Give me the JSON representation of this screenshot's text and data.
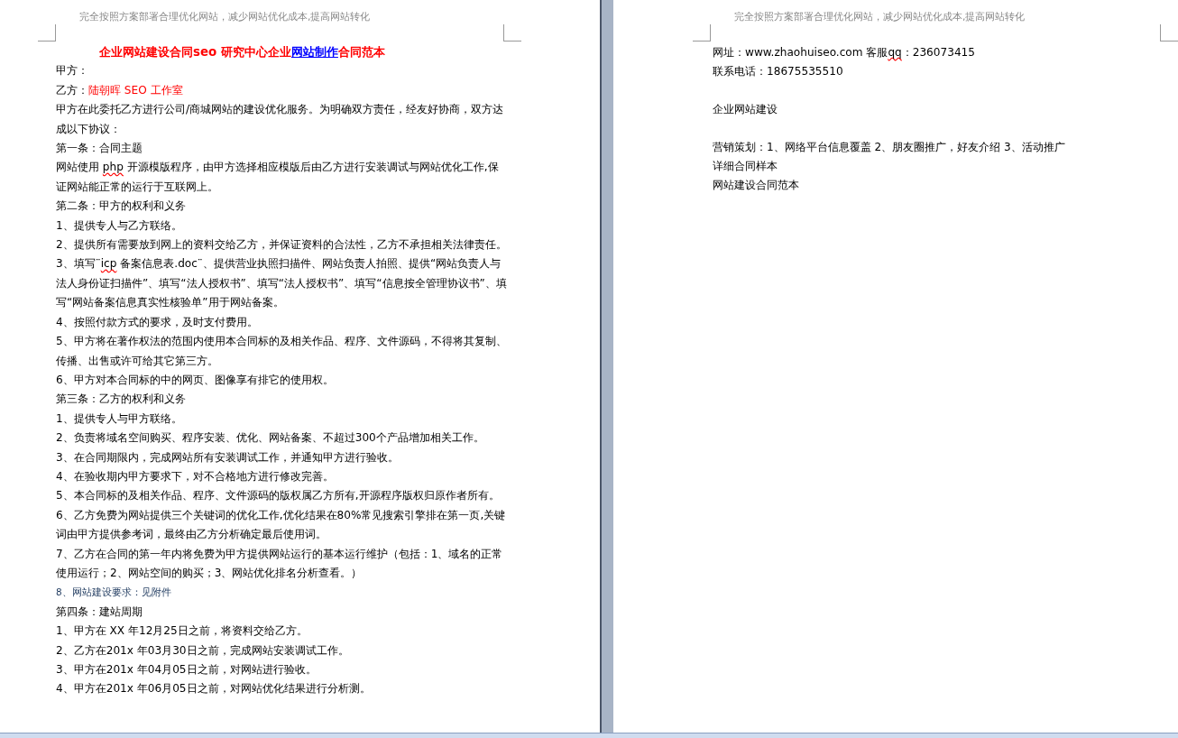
{
  "pages": [
    {
      "header": "完全按照方案部署合理优化网站，减少网站优化成本,提高网站转化",
      "paragraphs": [
        {
          "kind": "title",
          "runs": [
            {
              "text": "企业网站建设合同seo 研究中心企业",
              "kind": "red"
            },
            {
              "text": "网站制作",
              "kind": "link"
            },
            {
              "text": "合同范本",
              "kind": "red"
            }
          ]
        },
        {
          "kind": "body",
          "runs": [
            {
              "text": "甲方：",
              "kind": "normal"
            }
          ]
        },
        {
          "kind": "body",
          "runs": [
            {
              "text": "乙方：",
              "kind": "normal"
            },
            {
              "text": "陆朝晖 SEO 工作室",
              "kind": "red"
            }
          ]
        },
        {
          "kind": "body",
          "runs": [
            {
              "text": "甲方在此委托乙方进行公司/商城网站的建设优化服务。为明确双方责任，经友好协商，双方达成以下协议：",
              "kind": "normal"
            }
          ]
        },
        {
          "kind": "body",
          "runs": [
            {
              "text": "第一条：合同主题",
              "kind": "normal"
            }
          ]
        },
        {
          "kind": "body",
          "runs": [
            {
              "text": "网站使用 ",
              "kind": "normal"
            },
            {
              "text": "php",
              "kind": "spell"
            },
            {
              "text": " 开源模版程序，由甲方选择相应模版后由乙方进行安装调试与网站优化工作,保证网站能正常的运行于互联网上。",
              "kind": "normal"
            }
          ]
        },
        {
          "kind": "body",
          "runs": [
            {
              "text": "第二条：甲方的权利和义务",
              "kind": "normal"
            }
          ]
        },
        {
          "kind": "body",
          "runs": [
            {
              "text": "1、提供专人与乙方联络。",
              "kind": "normal"
            }
          ]
        },
        {
          "kind": "body",
          "runs": [
            {
              "text": "2、提供所有需要放到网上的资料交给乙方，并保证资料的合法性，乙方不承担相关法律责任。",
              "kind": "normal"
            }
          ]
        },
        {
          "kind": "body",
          "runs": [
            {
              "text": "3、填写¨",
              "kind": "normal"
            },
            {
              "text": "icp",
              "kind": "spell"
            },
            {
              "text": " 备案信息表.doc¨、提供营业执照扫描件、网站负责人拍照、提供“网站负责人与法人身份证扫描件”、填写“法人授权书”、填写“法人授权书”、填写“信息按全管理协议书”、填写“网站备案信息真实性核验单”用于网站备案。",
              "kind": "normal"
            }
          ]
        },
        {
          "kind": "body",
          "runs": [
            {
              "text": "4、按照付款方式的要求，及时支付费用。",
              "kind": "normal"
            }
          ]
        },
        {
          "kind": "body",
          "runs": [
            {
              "text": "5、甲方将在著作权法的范围内使用本合同标的及相关作品、程序、文件源码，不得将其复制、传播、出售或许可给其它第三方。",
              "kind": "normal"
            }
          ]
        },
        {
          "kind": "body",
          "runs": [
            {
              "text": "6、甲方对本合同标的中的网页、图像享有排它的使用权。",
              "kind": "normal"
            }
          ]
        },
        {
          "kind": "body",
          "runs": [
            {
              "text": "第三条：乙方的权利和义务",
              "kind": "normal"
            }
          ]
        },
        {
          "kind": "body",
          "runs": [
            {
              "text": "1、提供专人与甲方联络。",
              "kind": "normal"
            }
          ]
        },
        {
          "kind": "body",
          "runs": [
            {
              "text": "2、负责将域名空间购买、程序安装、优化、网站备案、不超过300个产品增加相关工作。",
              "kind": "normal"
            }
          ]
        },
        {
          "kind": "body",
          "runs": [
            {
              "text": "3、在合同期限内，完成网站所有安装调试工作，并通知甲方进行验收。",
              "kind": "normal"
            }
          ]
        },
        {
          "kind": "body",
          "runs": [
            {
              "text": "4、在验收期内甲方要求下，对不合格地方进行修改完善。",
              "kind": "normal"
            }
          ]
        },
        {
          "kind": "body",
          "runs": [
            {
              "text": "5、本合同标的及相关作品、程序、文件源码的版权属乙方所有,开源程序版权归原作者所有。",
              "kind": "normal"
            }
          ]
        },
        {
          "kind": "body",
          "runs": [
            {
              "text": "6、乙方免费为网站提供三个关键词的优化工作,优化结果在80%常见搜索引擎排在第一页,关键词由甲方提供参考词，最终由乙方分析确定最后使用词。",
              "kind": "normal"
            }
          ]
        },
        {
          "kind": "body",
          "runs": [
            {
              "text": "7、乙方在合同的第一年内将免费为甲方提供网站运行的基本运行维护（包括：1、域名的正常使用运行；2、网站空间的购买；3、网站优化排名分析查看。）",
              "kind": "normal"
            }
          ]
        },
        {
          "kind": "small",
          "runs": [
            {
              "text": "8、网站建设要求：见附件",
              "kind": "normal"
            }
          ]
        },
        {
          "kind": "body",
          "runs": [
            {
              "text": "第四条：建站周期",
              "kind": "normal"
            }
          ]
        },
        {
          "kind": "body",
          "runs": [
            {
              "text": "1、甲方在 XX 年12月25日之前，将资料交给乙方。",
              "kind": "normal"
            }
          ]
        },
        {
          "kind": "body",
          "runs": [
            {
              "text": "2、乙方在201x 年03月30日之前，完成网站安装调试工作。",
              "kind": "normal"
            }
          ]
        },
        {
          "kind": "body",
          "runs": [
            {
              "text": "3、甲方在201x 年04月05日之前，对网站进行验收。",
              "kind": "normal"
            }
          ]
        },
        {
          "kind": "body",
          "runs": [
            {
              "text": "4、甲方在201x 年06月05日之前，对网站优化结果进行分析测。",
              "kind": "normal"
            }
          ]
        }
      ]
    },
    {
      "header": "完全按照方案部署合理优化网站，减少网站优化成本,提高网站转化",
      "paragraphs": [
        {
          "kind": "body",
          "runs": [
            {
              "text": "网址：www.zhaohuiseo.com 客服",
              "kind": "normal"
            },
            {
              "text": "qq",
              "kind": "spell"
            },
            {
              "text": "：236073415",
              "kind": "normal"
            }
          ]
        },
        {
          "kind": "body",
          "runs": [
            {
              "text": "联系电话：18675535510",
              "kind": "normal"
            }
          ]
        },
        {
          "kind": "spaced",
          "runs": [
            {
              "text": "企业网站建设",
              "kind": "normal"
            }
          ]
        },
        {
          "kind": "spaced",
          "runs": [
            {
              "text": "营销策划：1、网络平台信息覆盖   2、朋友圈推广，好友介绍 3、活动推广",
              "kind": "normal"
            }
          ]
        },
        {
          "kind": "body",
          "runs": [
            {
              "text": "详细合同样本",
              "kind": "normal"
            }
          ]
        },
        {
          "kind": "body",
          "runs": [
            {
              "text": "网站建设合同范本",
              "kind": "normal"
            }
          ]
        }
      ]
    }
  ]
}
